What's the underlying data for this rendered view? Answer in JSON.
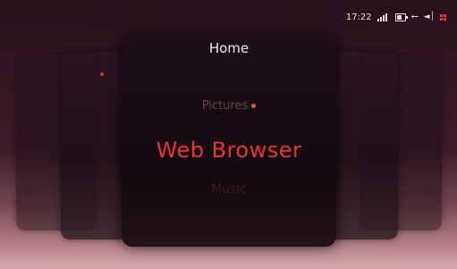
{
  "status_bar": {
    "clock": "17:22",
    "icons": [
      "signal-icon",
      "battery-icon",
      "usb-icon",
      "volume-icon",
      "grid-icon"
    ]
  },
  "main_panel": {
    "title": "Home"
  },
  "menu": {
    "previous": "Pictures",
    "current": "Web Browser",
    "next": "Music"
  },
  "colors": {
    "accent": "#e8343b",
    "background": "#2a1620"
  }
}
